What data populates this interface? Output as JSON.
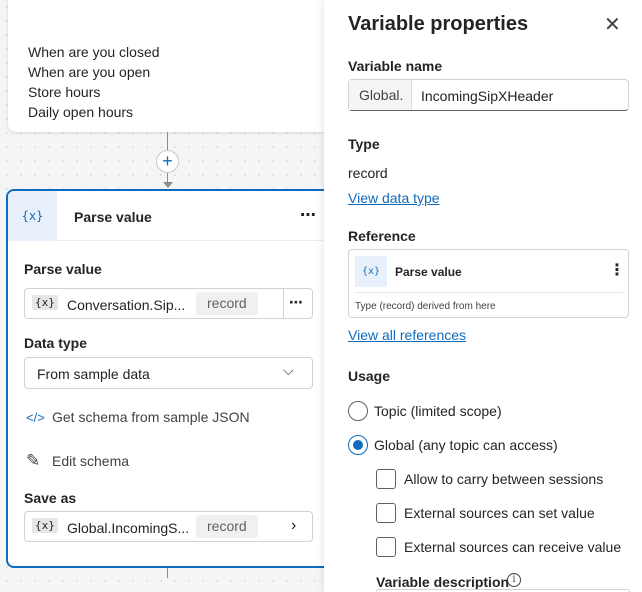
{
  "canvas": {
    "top_card_items": [
      "When are you closed",
      "When are you open",
      "Store hours",
      "Daily open hours"
    ],
    "add_symbol": "+",
    "node": {
      "icon": "{x}",
      "title": "Parse value",
      "more": "⋯",
      "parse_value_label": "Parse value",
      "parse_value_field": {
        "var_icon": "{x}",
        "name": "Conversation.Sip...",
        "type": "record",
        "more": "⋯"
      },
      "data_type_label": "Data type",
      "data_type_value": "From sample data",
      "data_type_chevron": "⌵",
      "get_schema": {
        "icon": "</>",
        "label": "Get schema from sample JSON"
      },
      "edit_schema": {
        "icon": "✎",
        "label": "Edit schema"
      },
      "save_as_label": "Save as",
      "save_as_field": {
        "var_icon": "{x}",
        "name": "Global.IncomingS...",
        "type": "record",
        "chevron": "›"
      }
    }
  },
  "panel": {
    "title": "Variable properties",
    "close": "✕",
    "variable_name_label": "Variable name",
    "name_prefix": "Global.",
    "name_value": "IncomingSipXHeader",
    "type_label": "Type",
    "type_value": "record",
    "view_data_type": "View data type",
    "reference_label": "Reference",
    "reference": {
      "icon": "{x}",
      "name": "Parse value",
      "more": "⋮",
      "note": "Type (record) derived from here"
    },
    "view_all_references": "View all references",
    "usage_label": "Usage",
    "usage_options": [
      {
        "label": "Topic (limited scope)",
        "selected": false
      },
      {
        "label": "Global (any topic can access)",
        "selected": true
      }
    ],
    "checkboxes": [
      {
        "label": "Allow to carry between sessions",
        "checked": false
      },
      {
        "label": "External sources can set value",
        "checked": false
      },
      {
        "label": "External sources can receive value",
        "checked": false
      }
    ],
    "variable_description_label": "Variable description",
    "info_icon": "i"
  },
  "colors": {
    "accent": "#0f6cbd",
    "accent_light": "#e8f1fb"
  }
}
